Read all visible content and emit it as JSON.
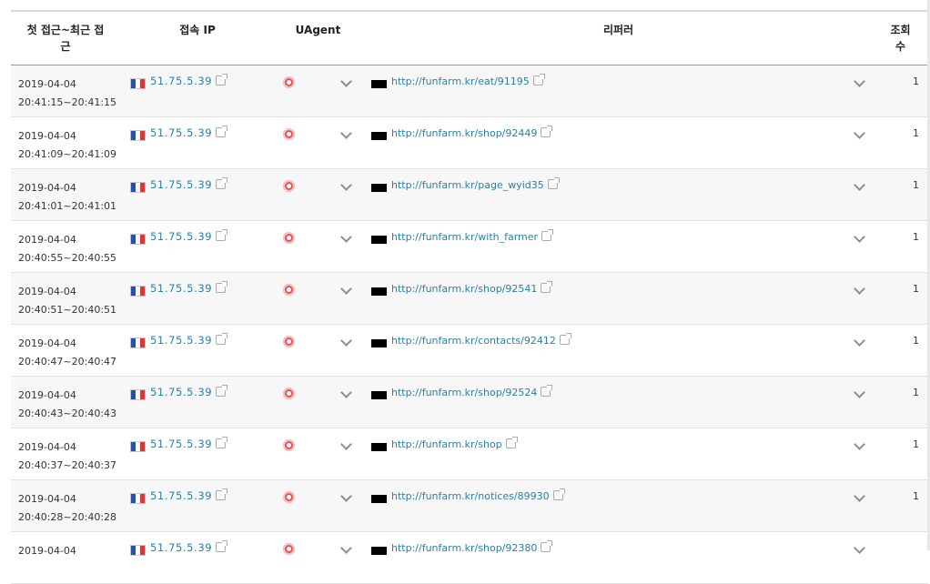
{
  "header": {
    "date_line1": "첫 접근~최근 접",
    "date_line2": "근",
    "ip": "접속 IP",
    "uagent": "UAgent",
    "referrer": "리퍼러",
    "count_line1": "조회",
    "count_line2": "수"
  },
  "flag_colors": [
    "#2b4fa3",
    "#ffffff",
    "#d33a3a"
  ],
  "rows": [
    {
      "date": "2019-04-04",
      "time": "20:41:15~20:41:15",
      "ip": "51.75.5.39",
      "ua_icon": "opera-icon",
      "referrer": "http://funfarm.kr/eat/91195",
      "count": "1"
    },
    {
      "date": "2019-04-04",
      "time": "20:41:09~20:41:09",
      "ip": "51.75.5.39",
      "ua_icon": "opera-icon",
      "referrer": "http://funfarm.kr/shop/92449",
      "count": "1"
    },
    {
      "date": "2019-04-04",
      "time": "20:41:01~20:41:01",
      "ip": "51.75.5.39",
      "ua_icon": "opera-icon",
      "referrer": "http://funfarm.kr/page_wyid35",
      "count": "1"
    },
    {
      "date": "2019-04-04",
      "time": "20:40:55~20:40:55",
      "ip": "51.75.5.39",
      "ua_icon": "opera-icon",
      "referrer": "http://funfarm.kr/with_farmer",
      "count": "1"
    },
    {
      "date": "2019-04-04",
      "time": "20:40:51~20:40:51",
      "ip": "51.75.5.39",
      "ua_icon": "opera-icon",
      "referrer": "http://funfarm.kr/shop/92541",
      "count": "1"
    },
    {
      "date": "2019-04-04",
      "time": "20:40:47~20:40:47",
      "ip": "51.75.5.39",
      "ua_icon": "opera-icon",
      "referrer": "http://funfarm.kr/contacts/92412",
      "count": "1"
    },
    {
      "date": "2019-04-04",
      "time": "20:40:43~20:40:43",
      "ip": "51.75.5.39",
      "ua_icon": "opera-icon",
      "referrer": "http://funfarm.kr/shop/92524",
      "count": "1"
    },
    {
      "date": "2019-04-04",
      "time": "20:40:37~20:40:37",
      "ip": "51.75.5.39",
      "ua_icon": "opera-icon",
      "referrer": "http://funfarm.kr/shop",
      "count": "1"
    },
    {
      "date": "2019-04-04",
      "time": "20:40:28~20:40:28",
      "ip": "51.75.5.39",
      "ua_icon": "opera-icon",
      "referrer": "http://funfarm.kr/notices/89930",
      "count": "1"
    },
    {
      "date": "2019-04-04",
      "time": "",
      "ip": "51.75.5.39",
      "ua_icon": "opera-icon",
      "referrer": "http://funfarm.kr/shop/92380",
      "count": ""
    }
  ]
}
